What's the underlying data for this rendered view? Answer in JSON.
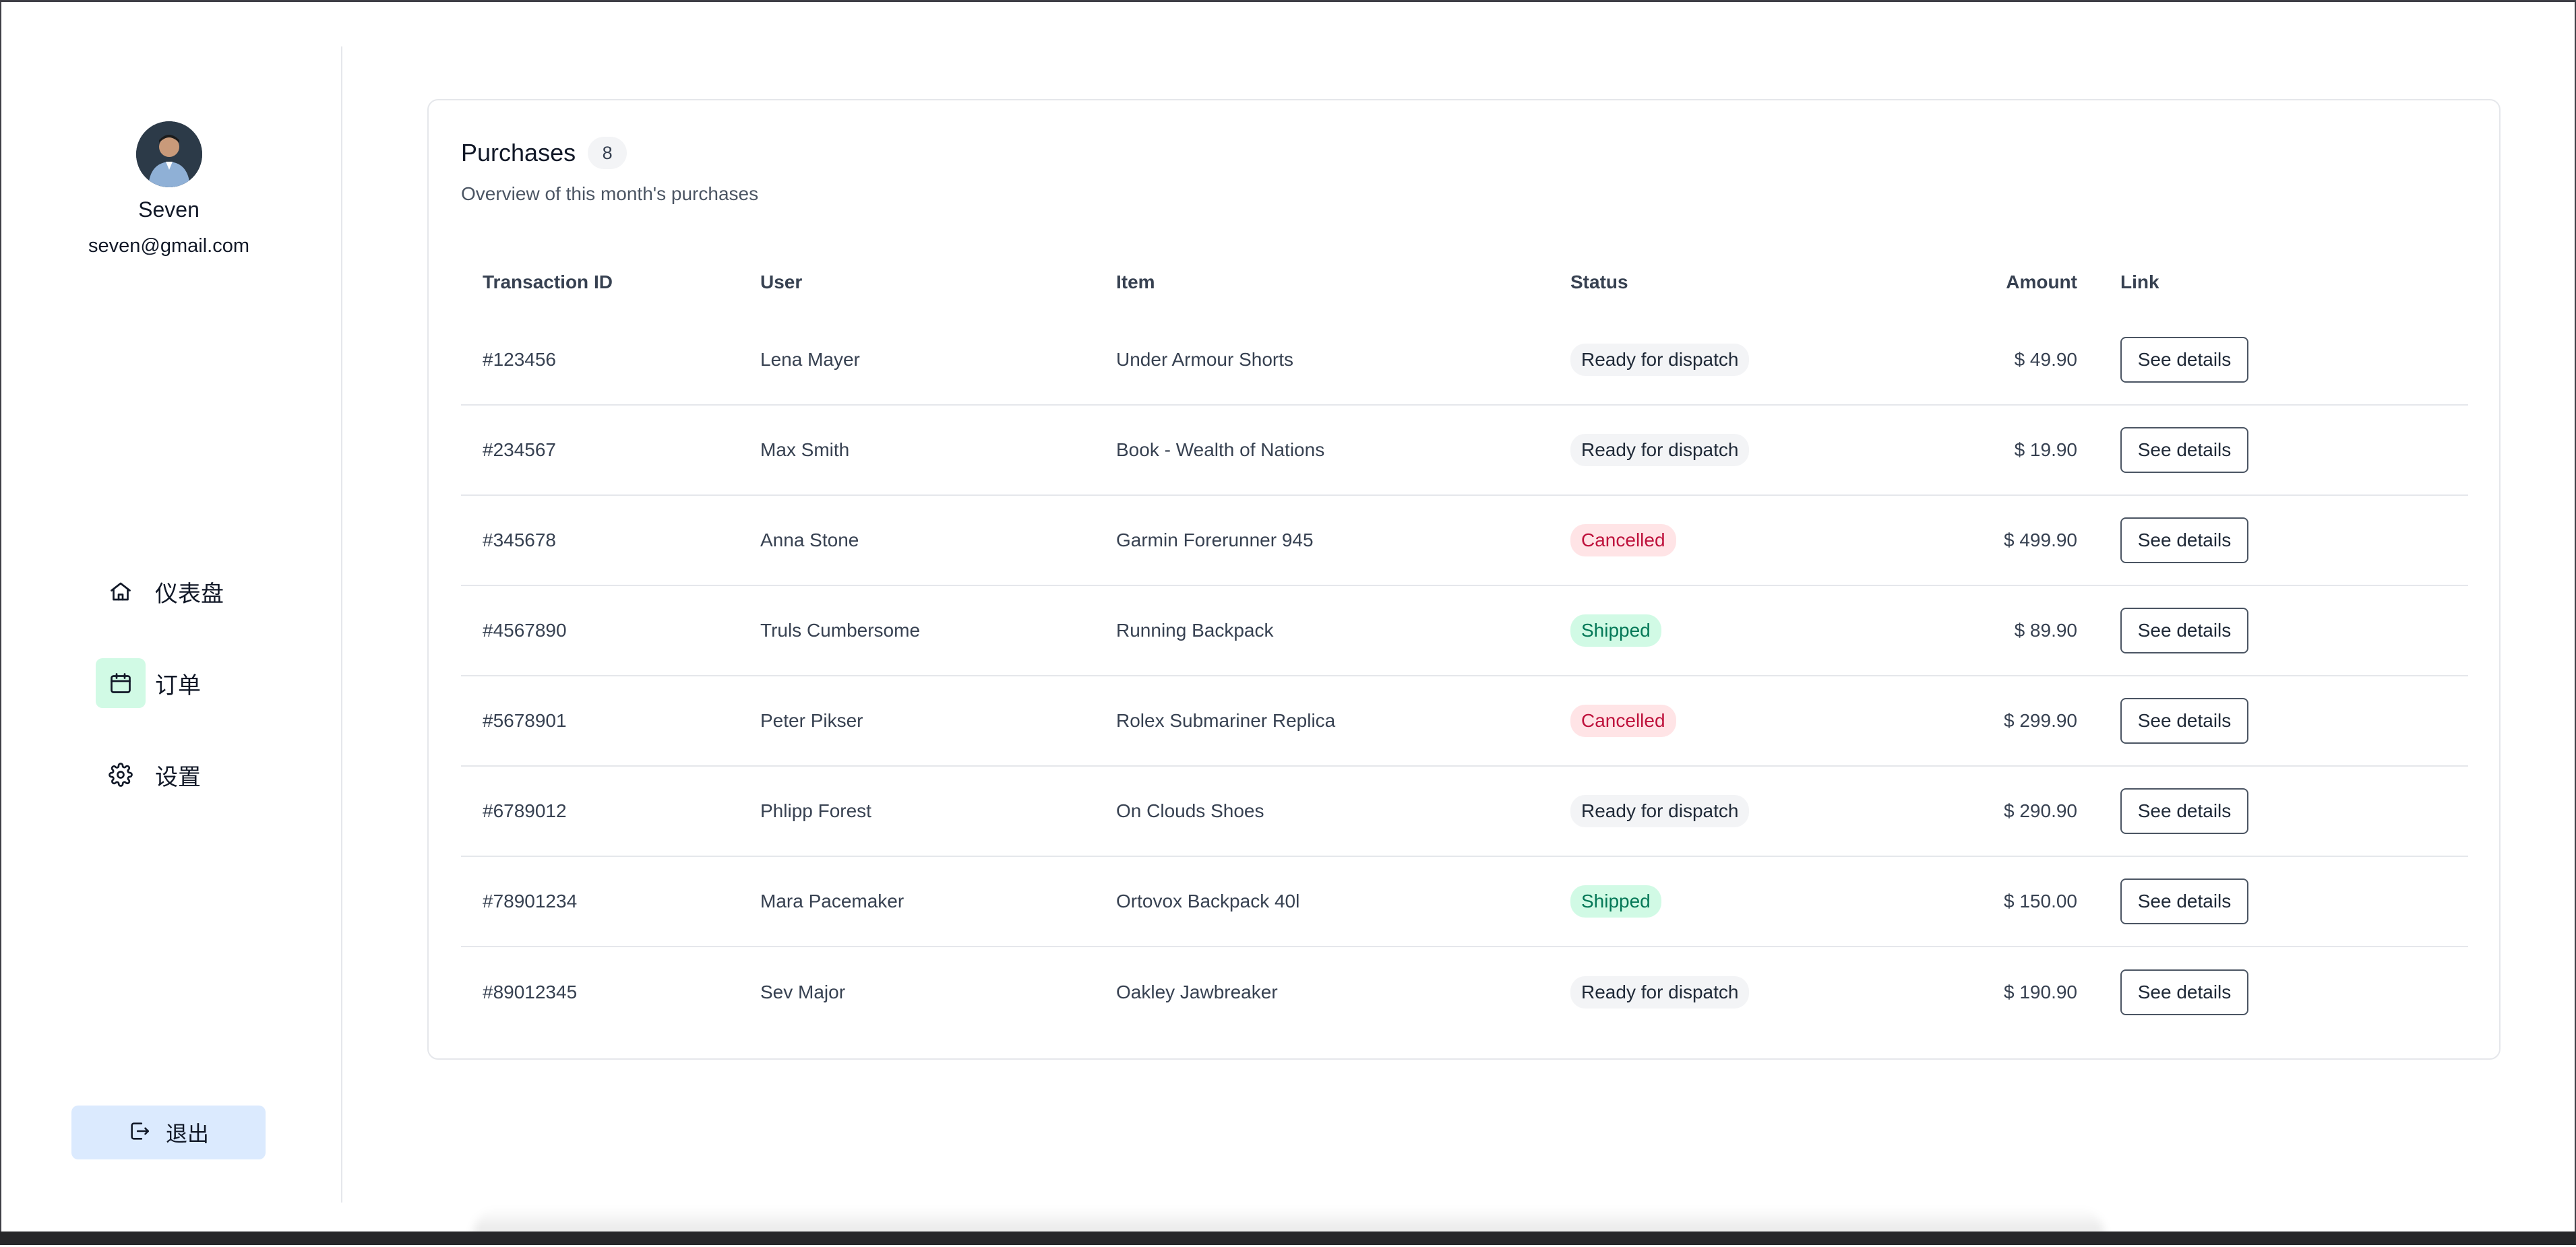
{
  "profile": {
    "name": "Seven",
    "email": "seven@gmail.com"
  },
  "nav": {
    "items": [
      {
        "label": "仪表盘",
        "icon": "home-icon",
        "active": false
      },
      {
        "label": "订单",
        "icon": "calendar-icon",
        "active": true
      },
      {
        "label": "设置",
        "icon": "gear-icon",
        "active": false
      }
    ],
    "logout_label": "退出"
  },
  "purchases": {
    "title": "Purchases",
    "count": "8",
    "subtitle": "Overview of this month's purchases",
    "columns": [
      "Transaction ID",
      "User",
      "Item",
      "Status",
      "Amount",
      "Link"
    ],
    "rows": [
      {
        "id": "#123456",
        "user": "Lena Mayer",
        "item": "Under Armour Shorts",
        "status": "Ready for dispatch",
        "status_type": "ready",
        "amount": "$ 49.90",
        "link": "See details"
      },
      {
        "id": "#234567",
        "user": "Max Smith",
        "item": "Book - Wealth of Nations",
        "status": "Ready for dispatch",
        "status_type": "ready",
        "amount": "$ 19.90",
        "link": "See details"
      },
      {
        "id": "#345678",
        "user": "Anna Stone",
        "item": "Garmin Forerunner 945",
        "status": "Cancelled",
        "status_type": "cancelled",
        "amount": "$ 499.90",
        "link": "See details"
      },
      {
        "id": "#4567890",
        "user": "Truls Cumbersome",
        "item": "Running Backpack",
        "status": "Shipped",
        "status_type": "shipped",
        "amount": "$ 89.90",
        "link": "See details"
      },
      {
        "id": "#5678901",
        "user": "Peter Pikser",
        "item": "Rolex Submariner Replica",
        "status": "Cancelled",
        "status_type": "cancelled",
        "amount": "$ 299.90",
        "link": "See details"
      },
      {
        "id": "#6789012",
        "user": "Phlipp Forest",
        "item": "On Clouds Shoes",
        "status": "Ready for dispatch",
        "status_type": "ready",
        "amount": "$ 290.90",
        "link": "See details"
      },
      {
        "id": "#78901234",
        "user": "Mara Pacemaker",
        "item": "Ortovox Backpack 40l",
        "status": "Shipped",
        "status_type": "shipped",
        "amount": "$ 150.00",
        "link": "See details"
      },
      {
        "id": "#89012345",
        "user": "Sev Major",
        "item": "Oakley Jawbreaker",
        "status": "Ready for dispatch",
        "status_type": "ready",
        "amount": "$ 190.90",
        "link": "See details"
      }
    ]
  },
  "colors": {
    "ready_bg": "#f3f4f6",
    "cancelled_bg": "#ffe4e6",
    "cancelled_text": "#be123c",
    "shipped_bg": "#d1fae5",
    "shipped_text": "#047857",
    "active_nav_bg": "#d1fae5",
    "logout_bg": "#dbeafe"
  }
}
